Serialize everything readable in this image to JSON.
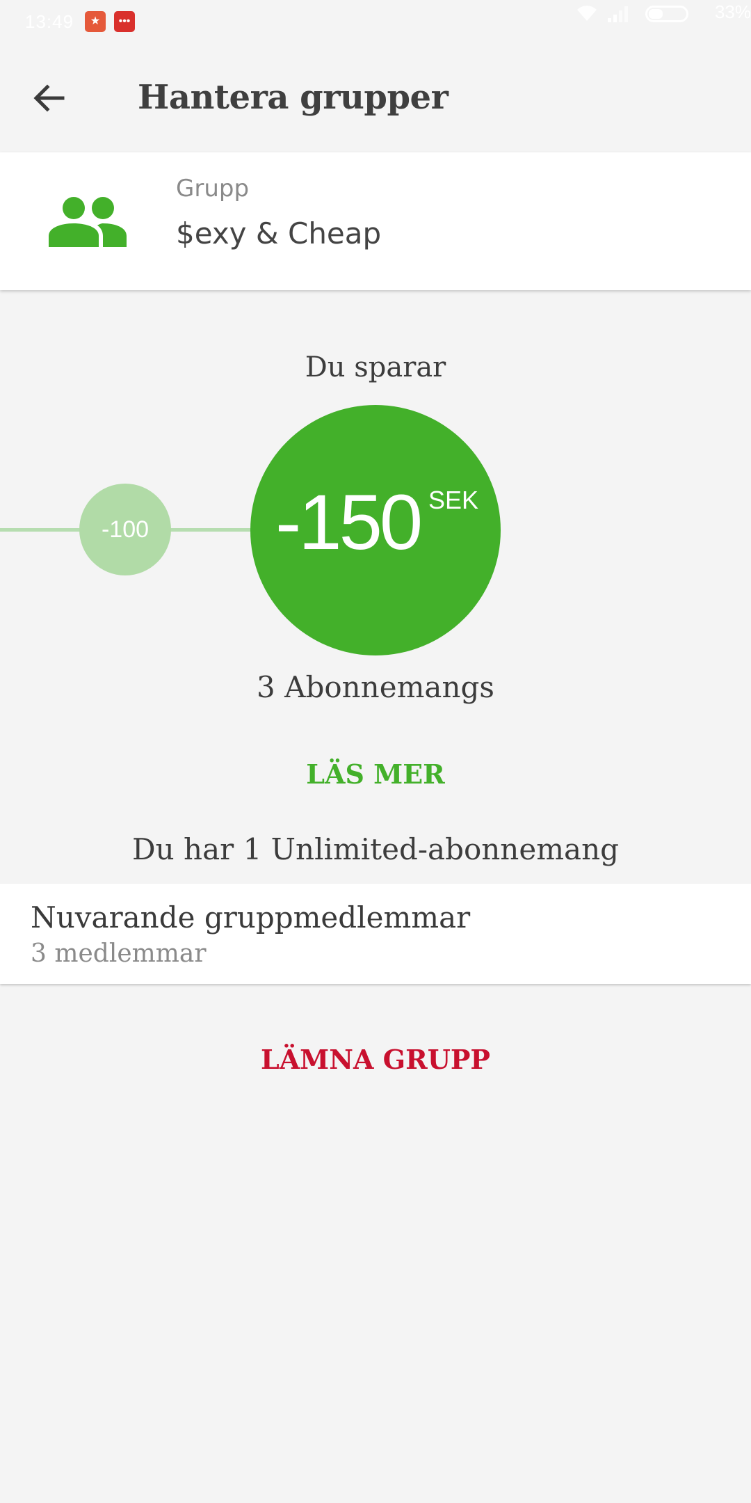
{
  "status_bar": {
    "time": "13:49",
    "battery": "33%"
  },
  "toolbar": {
    "title": "Hantera grupper"
  },
  "group": {
    "label": "Grupp",
    "name": "$exy & Cheap"
  },
  "savings": {
    "label": "Du sparar",
    "previous_value": "-100",
    "current_value": "-150",
    "unit": "SEK",
    "subscriptions": "3 Abonnemangs"
  },
  "read_more": "LÄS MER",
  "unlimited_text": "Du har 1 Unlimited-abonnemang",
  "members": {
    "title": "Nuvarande gruppmedlemmar",
    "count": "3 medlemmar"
  },
  "leave_group": "LÄMNA GRUPP",
  "colors": {
    "accent": "#43b02a",
    "accent_light": "#b1dba7",
    "danger": "#c8102e"
  }
}
